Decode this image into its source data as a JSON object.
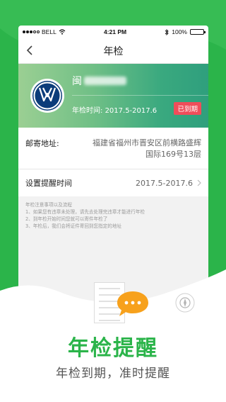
{
  "status_bar": {
    "carrier": "BELL",
    "time": "4:21 PM",
    "battery": "100%",
    "battery_level": 1.0
  },
  "nav": {
    "title": "年检",
    "back_icon": "chevron-left-icon"
  },
  "vehicle": {
    "plate_prefix": "闽",
    "brand_logo": "volkswagen-logo",
    "inspection_label": "年检时间:",
    "inspection_period": "2017.5-2017.6",
    "status_badge": "已到期",
    "badge_color": "#f04d5a"
  },
  "address": {
    "label": "邮寄地址:",
    "line1": "福建省福州市晋安区前横路盛辉",
    "line2": "国际169号13层"
  },
  "reminder": {
    "label": "设置提醒时间",
    "value": "2017.5-2017.6"
  },
  "notes": {
    "title": "年检注意事项以及流程",
    "item1": "1、如果您有违章未处理，请先去处理完违章才能进行年检",
    "item2": "2、到年检开始时间您就可以寄件年检了",
    "item3": "3、年检后，我们会将证件寄回到您指定的地址"
  },
  "promo": {
    "headline": "年检提醒",
    "subline": "年检到期，准时提醒",
    "accent_color": "#2bb44a"
  }
}
